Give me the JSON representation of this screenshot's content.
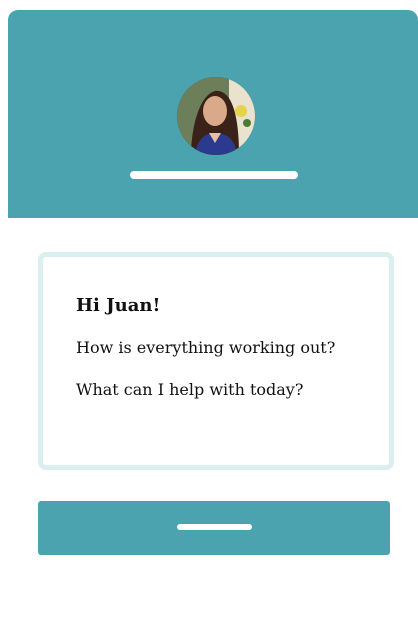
{
  "colors": {
    "header_background": "#4aa3ae",
    "button_background": "#4aa3ae",
    "message_border": "#dbeef0",
    "text": "#111111"
  },
  "header": {
    "avatar_icon": "person-avatar-icon"
  },
  "message": {
    "greeting": "Hi Juan!",
    "line1": "How is everything working out?",
    "line2": "What can I help with today?"
  }
}
